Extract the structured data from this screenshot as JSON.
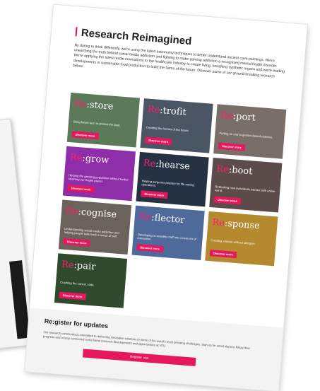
{
  "header": {
    "title": "Research Reimagined"
  },
  "intro": "By daring to think differently, we're using the latest astronomy techniques to better understand ancient cave paintings. We're unearthing the truth behind social media addiction and fighting to make gaming addiction a recognised mental health disorder. We're applying the latest textile innovations to the healthcare industry to create living, breathing synthetic organs and we're leading developments in sustainable food production to build the farms of the future. Discover some of our ground-breaking research below.",
  "tiles": [
    {
      "prefix": "Re",
      "suffix": ":store",
      "desc": "Using future tech to protect the past.",
      "button": "Discover more",
      "color": "#5c7a5a"
    },
    {
      "prefix": "Re",
      "suffix": ":trofit",
      "desc": "Creating the homes of the future.",
      "button": "Discover more",
      "color": "#4b5665"
    },
    {
      "prefix": "Re",
      "suffix": ":port",
      "desc": "Putting an end to gender-based violence.",
      "button": "Discover more",
      "color": "#7a6e68"
    },
    {
      "prefix": "Re",
      "suffix": ":grow",
      "desc": "Helping the growing population without further straining our fragile planet.",
      "button": "Discover more",
      "color": "#8e2ea8"
    },
    {
      "prefix": "Re",
      "suffix": ":hearse",
      "desc": "Helping surgeons prepare for life-saving operations.",
      "button": "Discover more",
      "color": "#243244"
    },
    {
      "prefix": "Re",
      "suffix": ":boot",
      "desc": "Rethinking how individuals interact with online world.",
      "button": "Discover more",
      "color": "#5b4b4a"
    },
    {
      "prefix": "Re",
      "suffix": ":cognise",
      "desc": "Understanding social media addiction and helping people take back a sense of self.",
      "button": "Discover more",
      "color": "#6b625c"
    },
    {
      "prefix": "Re",
      "suffix": ":flector",
      "desc": "Developing a reusable craft into a new era of innovation.",
      "button": "Discover more",
      "color": "#4d6a9a"
    },
    {
      "prefix": "Re",
      "suffix": ":sponse",
      "desc": "Creating a future without allergies.",
      "button": "Discover more",
      "color": "#b58a2f"
    },
    {
      "prefix": "Re",
      "suffix": ":pair",
      "desc": "Cracking the cancer code.",
      "button": "Discover more",
      "color": "#2f4a2c"
    }
  ],
  "register": {
    "title": "Re:gister for updates",
    "text": "Our research community is committed to delivering innovative solutions to some of the world's most pressing challenges. Sign up for email alerts to follow their progress and to stay connected to the latest research developments and opportunities at NTU.",
    "button": "Register now"
  }
}
